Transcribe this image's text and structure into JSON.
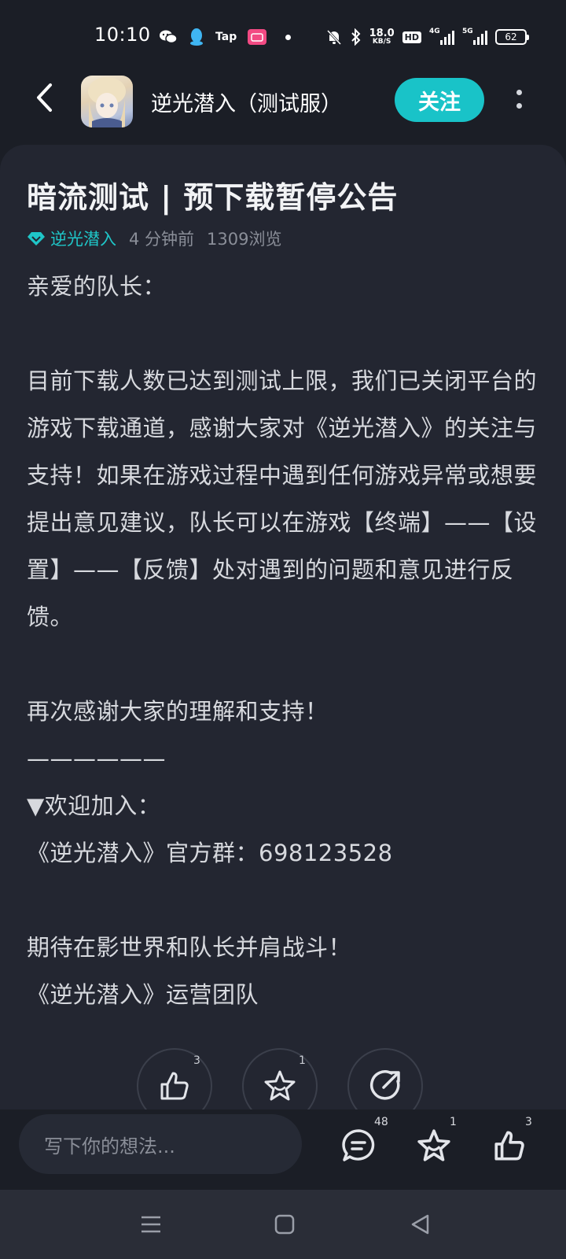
{
  "status_bar": {
    "time": "10:10",
    "app_icons": [
      "wechat-icon",
      "qq-icon",
      "tap-icon",
      "bilibili-icon"
    ],
    "tap_label": "Tap",
    "net_speed_value": "18.0",
    "net_speed_unit": "KB/S",
    "hd_label": "HD",
    "signal_1_label": "4G",
    "signal_2_label": "5G",
    "battery": "62"
  },
  "header": {
    "title": "逆光潜入（测试服）",
    "follow_label": "关注"
  },
  "post": {
    "title": "暗流测试 | 预下载暂停公告",
    "author": "逆光潜入",
    "time": "4 分钟前",
    "views": "1309浏览",
    "paragraphs": [
      "亲爱的队长：",
      "",
      "目前下载人数已达到测试上限，我们已关闭平台的游戏下载通道，感谢大家对《逆光潜入》的关注与支持！如果在游戏过程中遇到任何游戏异常或想要提出意见建议，队长可以在游戏【终端】——【设置】——【反馈】处对遇到的问题和意见进行反馈。",
      "",
      "再次感谢大家的理解和支持！",
      "——————",
      "▼欢迎加入：",
      "《逆光潜入》官方群：698123528",
      "",
      "期待在影世界和队长并肩战斗！",
      "《逆光潜入》运营团队"
    ]
  },
  "post_actions": {
    "like_count": "3",
    "favorite_count": "1"
  },
  "comment_bar": {
    "placeholder": "写下你的想法...",
    "comment_count": "48",
    "favorite_count": "1",
    "like_count": "3"
  },
  "colors": {
    "accent": "#19c3c8",
    "background": "#1b1e26",
    "card": "#232631"
  }
}
